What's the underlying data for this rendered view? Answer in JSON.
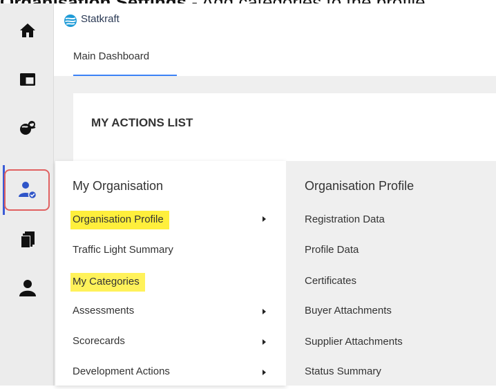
{
  "caption": {
    "bold_text": "Organisation Settings",
    "rest_text": " - Add categories to the profile"
  },
  "header": {
    "brand": "Statkraft",
    "tab": "Main Dashboard"
  },
  "dashboard": {
    "card_title": "MY ACTIONS LIST"
  },
  "sidebar": {
    "icons": [
      "home-icon",
      "dashboard-icon",
      "network-icon",
      "organisation-user-icon",
      "documents-icon",
      "user-icon"
    ],
    "active": "organisation-user-icon"
  },
  "menu": {
    "heading": "My Organisation",
    "items": [
      {
        "label": "Organisation Profile",
        "has_submenu": true,
        "highlighted": true
      },
      {
        "label": "Traffic Light Summary",
        "has_submenu": false,
        "highlighted": false
      },
      {
        "label": "My Categories",
        "has_submenu": false,
        "highlighted": true
      },
      {
        "label": "Assessments",
        "has_submenu": true,
        "highlighted": false
      },
      {
        "label": "Scorecards",
        "has_submenu": true,
        "highlighted": false
      },
      {
        "label": "Development Actions",
        "has_submenu": true,
        "highlighted": false
      }
    ]
  },
  "submenu": {
    "heading": "Organisation Profile",
    "items": [
      "Registration Data",
      "Profile Data",
      "Certificates",
      "Buyer Attachments",
      "Supplier Attachments",
      "Status Summary"
    ]
  },
  "colors": {
    "highlight": "#ffef3c",
    "accent": "#3b5bd6",
    "annotation": "#e06060"
  }
}
